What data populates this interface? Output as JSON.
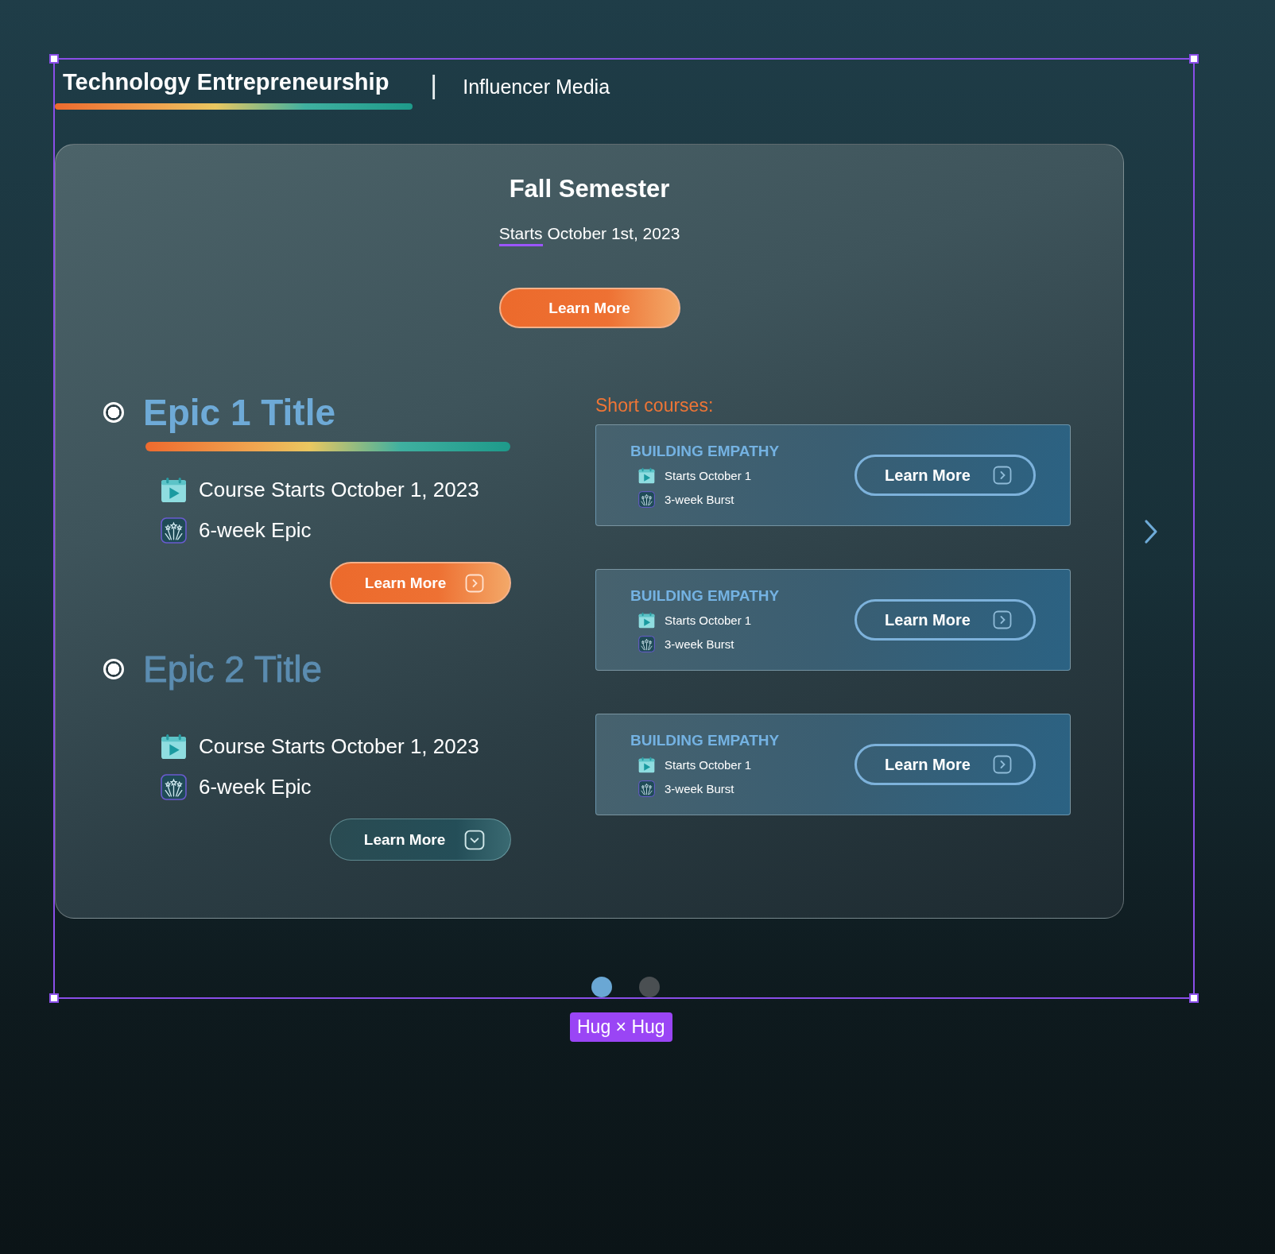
{
  "tabs": [
    {
      "label": "Technology Entrepreneurship",
      "selected": true
    },
    {
      "label": "Influencer Media",
      "selected": false
    }
  ],
  "tab_separator": "|",
  "semester": {
    "title": "Fall Semester",
    "subtitle_parts": [
      {
        "text": "Starts",
        "flagged": true
      },
      {
        "text": "October 1st, 2023",
        "flagged": false
      }
    ],
    "button": "Learn More"
  },
  "epics": [
    {
      "title": "Epic 1 Title",
      "selected": true,
      "checked": true,
      "details": [
        {
          "kind": "date",
          "text": "Course Starts October 1, 2023"
        },
        {
          "kind": "duration",
          "text": "6-week Epic"
        }
      ],
      "button": "Learn More"
    },
    {
      "title": "Epic 2 Title",
      "selected": false,
      "checked": true,
      "details": [
        {
          "kind": "date",
          "text": "Course Starts October 1, 2023"
        },
        {
          "kind": "duration",
          "text": "6-week Epic"
        }
      ],
      "button": "Learn More"
    }
  ],
  "short_courses": {
    "heading": "Short courses:",
    "items": [
      {
        "title": "BUILDING EMPATHY",
        "details": [
          {
            "kind": "date",
            "text": "Starts October 1"
          },
          {
            "kind": "duration",
            "text": "3-week Burst"
          }
        ],
        "button": "Learn More"
      },
      {
        "title": "BUILDING EMPATHY",
        "details": [
          {
            "kind": "date",
            "text": "Starts October 1"
          },
          {
            "kind": "duration",
            "text": "3-week Burst"
          }
        ],
        "button": "Learn More"
      },
      {
        "title": "BUILDING EMPATHY",
        "details": [
          {
            "kind": "date",
            "text": "Starts October 1"
          },
          {
            "kind": "duration",
            "text": "3-week Burst"
          }
        ],
        "button": "Learn More"
      }
    ]
  },
  "pager": [
    {
      "selected": true
    },
    {
      "selected": false
    }
  ],
  "selection_label": "Hug × Hug"
}
